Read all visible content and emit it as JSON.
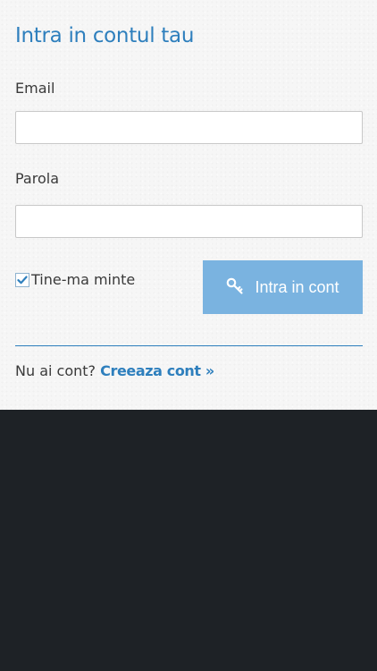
{
  "login": {
    "title": "Intra in contul tau",
    "email_label": "Email",
    "email_value": "",
    "password_label": "Parola",
    "password_value": "",
    "remember_label": "Tine-ma minte",
    "remember_checked": true,
    "submit_label": "Intra in cont",
    "submit_icon": "key-icon"
  },
  "signup": {
    "prompt": "Nu ai cont?",
    "link_label": "Creeaza cont »"
  },
  "colors": {
    "accent": "#2e7fbd",
    "button": "#7ab3e0",
    "footer_background": "#1e2226"
  }
}
